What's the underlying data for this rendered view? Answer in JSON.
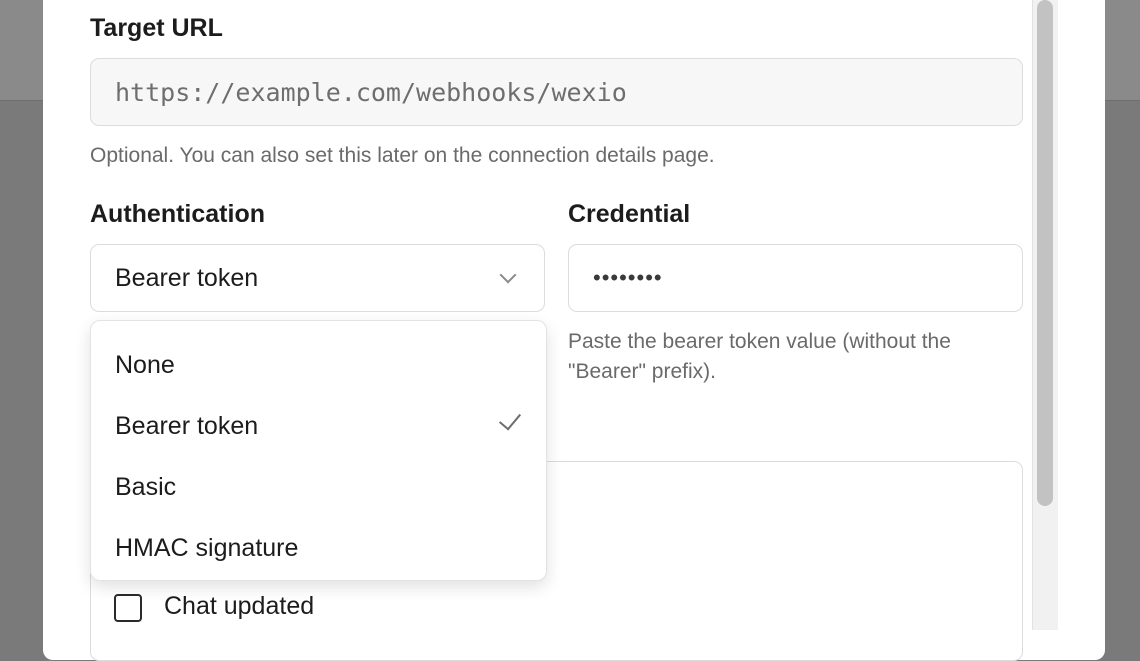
{
  "target_url": {
    "label": "Target URL",
    "placeholder": "https://example.com/webhooks/wexio",
    "hint": "Optional. You can also set this later on the connection details page."
  },
  "authentication": {
    "label": "Authentication",
    "selected": "Bearer token",
    "options": [
      {
        "label": "None",
        "checked": false
      },
      {
        "label": "Bearer token",
        "checked": true
      },
      {
        "label": "Basic",
        "checked": false
      },
      {
        "label": "HMAC signature",
        "checked": false
      }
    ]
  },
  "credential": {
    "label": "Credential",
    "masked_value": "••••••••",
    "hint_line1": "Paste the bearer token value (without the",
    "hint_line2": "\"Bearer\" prefix)."
  },
  "events": {
    "items": [
      {
        "label": "Chat updated",
        "checked": false
      }
    ]
  },
  "icons": {
    "select_chevron": "chevron-down-icon",
    "selected_check": "check-icon"
  },
  "colors": {
    "overlay": "#7a7a7a",
    "modal_bg": "#ffffff",
    "border": "#dcdcdc",
    "hint_text": "#6a6a6a"
  }
}
